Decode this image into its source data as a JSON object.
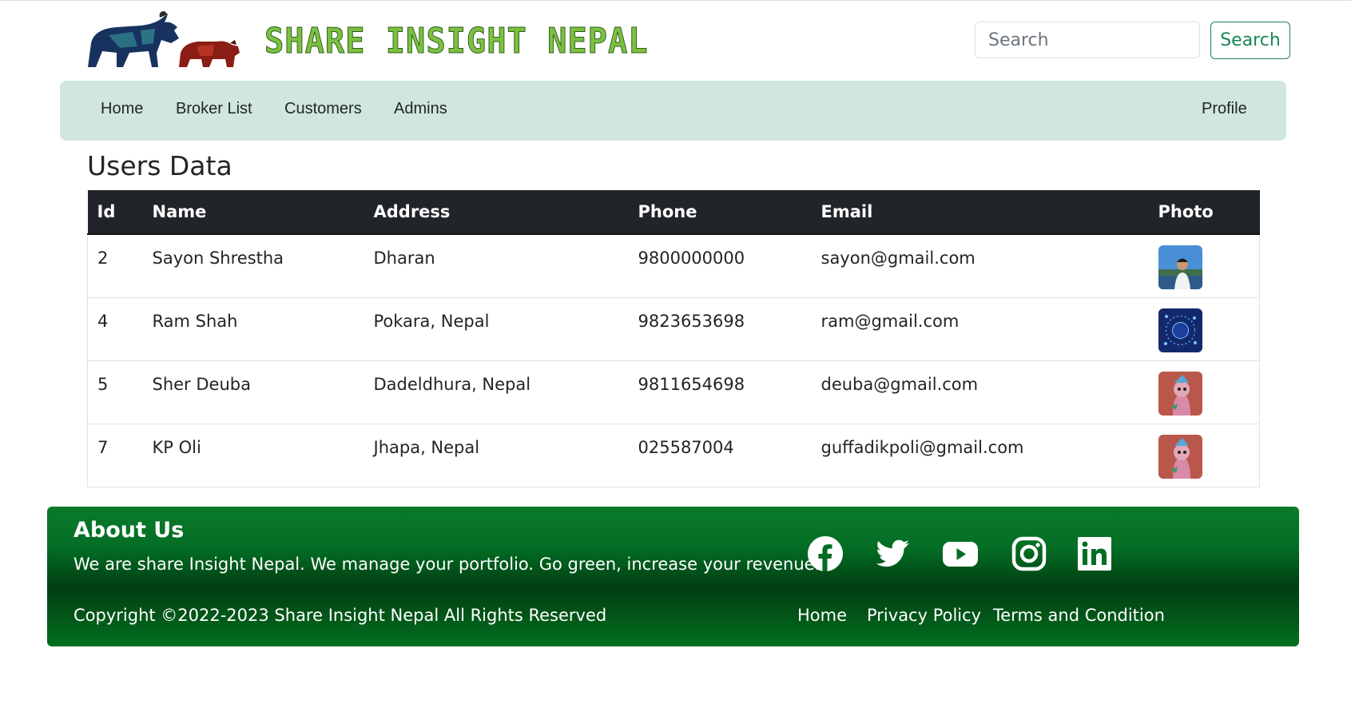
{
  "header": {
    "brand": "SHARE INSIGHT NEPAL",
    "search_placeholder": "Search",
    "search_button": "Search"
  },
  "nav": {
    "items": [
      {
        "label": "Home"
      },
      {
        "label": "Broker List"
      },
      {
        "label": "Customers"
      },
      {
        "label": "Admins"
      }
    ],
    "profile": "Profile"
  },
  "page": {
    "title": "Users Data"
  },
  "table": {
    "columns": [
      "Id",
      "Name",
      "Address",
      "Phone",
      "Email",
      "Photo"
    ],
    "rows": [
      {
        "id": "2",
        "name": "Sayon Shrestha",
        "address": "Dharan",
        "phone": "9800000000",
        "email": "sayon@gmail.com",
        "photo": "person-photo"
      },
      {
        "id": "4",
        "name": "Ram Shah",
        "address": "Pokara, Nepal",
        "phone": "9823653698",
        "email": "ram@gmail.com",
        "photo": "crypto-photo"
      },
      {
        "id": "5",
        "name": "Sher Deuba",
        "address": "Dadeldhura, Nepal",
        "phone": "9811654698",
        "email": "deuba@gmail.com",
        "photo": "ape-photo"
      },
      {
        "id": "7",
        "name": "KP Oli",
        "address": "Jhapa, Nepal",
        "phone": "025587004",
        "email": "guffadikpoli@gmail.com",
        "photo": "ape-photo"
      }
    ]
  },
  "footer": {
    "about_title": "About Us",
    "about_text": "We are share Insight Nepal. We manage your portfolio. Go green, increase your revenue.",
    "copyright": "Copyright ©2022-2023 Share Insight Nepal All Rights Reserved",
    "social_icons": [
      "facebook-icon",
      "twitter-icon",
      "youtube-icon",
      "instagram-icon",
      "linkedin-icon"
    ],
    "links": [
      {
        "label": "Home"
      },
      {
        "label": "Privacy Policy"
      },
      {
        "label": "Terms and Condition"
      }
    ]
  },
  "colors": {
    "nav_bg": "#d1e7dd",
    "accent": "#198754",
    "table_head": "#212529",
    "footer_green": "#036d24"
  }
}
